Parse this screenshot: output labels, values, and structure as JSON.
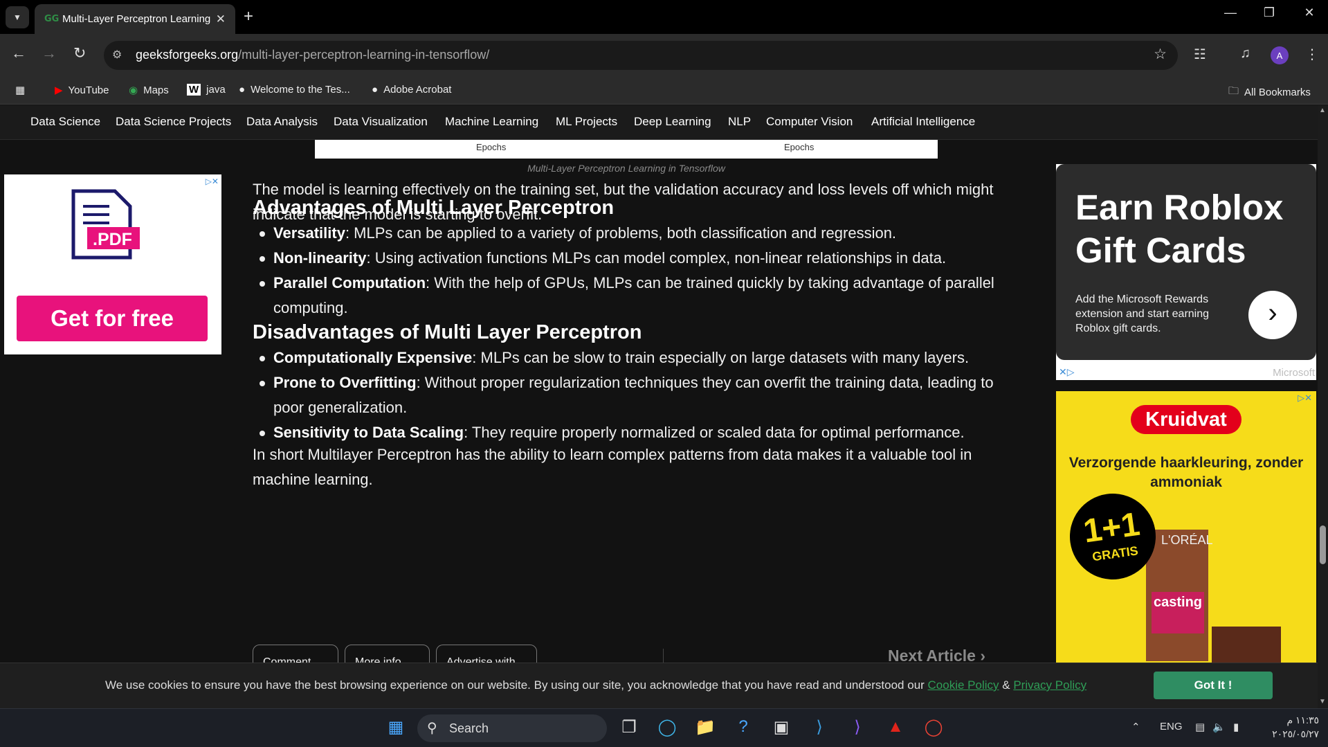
{
  "browser": {
    "tab_title": "Multi-Layer Perceptron Learning",
    "tab_favicon": "GG",
    "url_domain": "geeksforgeeks.org",
    "url_path": "/multi-layer-perceptron-learning-in-tensorflow/",
    "profile_initial": "A"
  },
  "bookmarks": {
    "items": [
      "YouTube",
      "Maps",
      "java",
      "Welcome to the Tes...",
      "Adobe Acrobat"
    ],
    "all_label": "All Bookmarks"
  },
  "nav": {
    "items": [
      "Data Science",
      "Data Science Projects",
      "Data Analysis",
      "Data Visualization",
      "Machine Learning",
      "ML Projects",
      "Deep Learning",
      "NLP",
      "Computer Vision",
      "Artificial Intelligence"
    ]
  },
  "article": {
    "figure_axis_left": "Epochs",
    "figure_axis_right": "Epochs",
    "caption": "Multi-Layer Perceptron Learning in Tensorflow",
    "intro": "The model is learning effectively on the training set, but the validation accuracy and loss levels off which might indicate that the model is starting to overfit.",
    "advantages_heading": "Advantages of Multi Layer Perceptron",
    "advantages": [
      {
        "term": "Versatility",
        "text": ": MLPs can be applied to a variety of problems, both classification and regression."
      },
      {
        "term": "Non-linearity",
        "text": ": Using activation functions MLPs can model complex, non-linear relationships in data."
      },
      {
        "term": "Parallel Computation",
        "text": ": With the help of GPUs, MLPs can be trained quickly by taking advantage of parallel computing."
      }
    ],
    "disadvantages_heading": "Disadvantages of Multi Layer Perceptron",
    "disadvantages": [
      {
        "term": "Computationally Expensive",
        "text": ": MLPs can be slow to train especially on large datasets with many layers."
      },
      {
        "term": "Prone to Overfitting",
        "text": ": Without proper regularization techniques they can overfit the training data, leading to poor generalization."
      },
      {
        "term": "Sensitivity to Data Scaling",
        "text": ": They require properly normalized or scaled data for optimal performance."
      }
    ],
    "conclusion": "In short Multilayer Perceptron has the ability to learn complex patterns from data makes it a valuable tool in machine learning.",
    "buttons": {
      "comment": "Comment",
      "more_info": "More info",
      "advertise": "Advertise with us"
    },
    "next_article": "Next Article"
  },
  "ads": {
    "left": {
      "file_label": ".PDF",
      "cta": "Get for free"
    },
    "right_top": {
      "headline": "Earn Roblox Gift Cards",
      "sub": "Add the Microsoft Rewards extension and start earning Roblox gift cards.",
      "sponsor": "Microsoft"
    },
    "right_bottom": {
      "brand": "Kruidvat",
      "copy": "Verzorgende haarkleuring, zonder ammoniak",
      "deal": "1+1",
      "deal_sub": "GRATIS",
      "product": "casting",
      "brand2": "L'ORÉAL"
    }
  },
  "cookie": {
    "message": "We use cookies to ensure you have the best browsing experience on our website. By using our site, you acknowledge that you have read and understood our ",
    "cookie_policy": "Cookie Policy",
    "amp": " & ",
    "privacy_policy": "Privacy Policy",
    "button": "Got It !"
  },
  "taskbar": {
    "search_label": "Search",
    "language": "ENG",
    "time": "١١:٣٥ م",
    "date": "٢٠٢٥/٠٥/٢٧"
  },
  "colors": {
    "accent": "#2f8d46",
    "cookie_button": "#2f8d62",
    "ad_cta": "#e8127c",
    "ad_yellow": "#f6dc1a"
  }
}
